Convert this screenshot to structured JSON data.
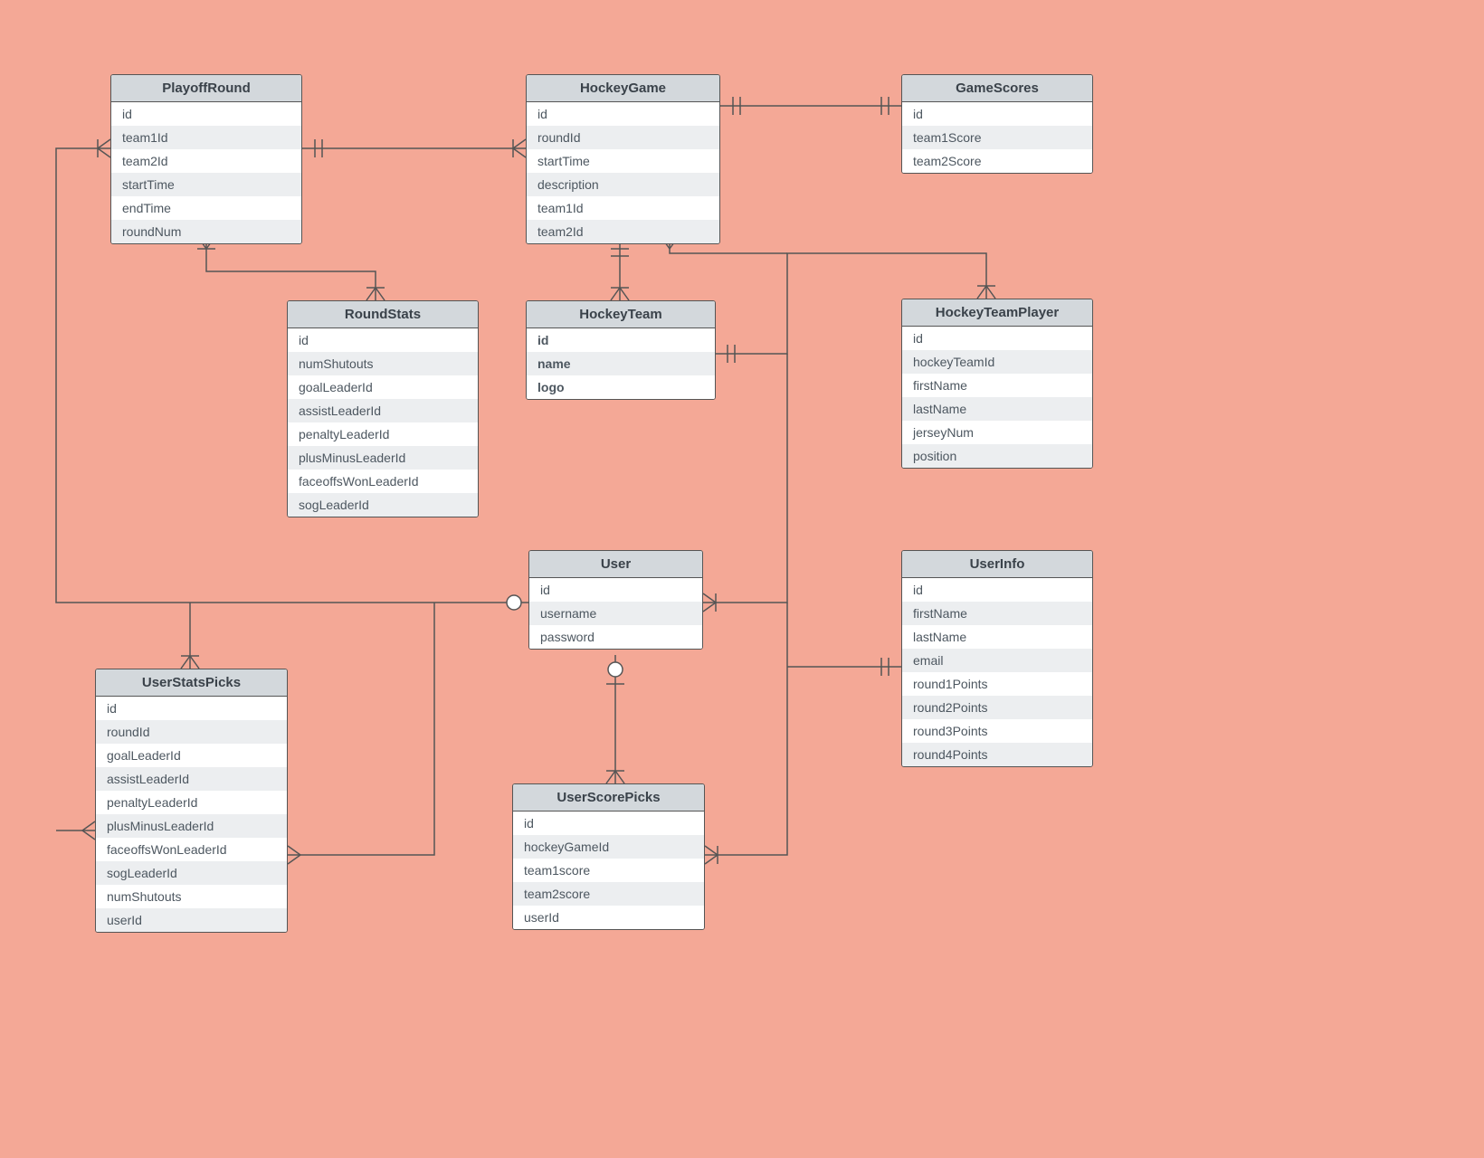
{
  "entities": {
    "playoffRound": {
      "title": "PlayoffRound",
      "rows": [
        "id",
        "team1Id",
        "team2Id",
        "startTime",
        "endTime",
        "roundNum"
      ]
    },
    "hockeyGame": {
      "title": "HockeyGame",
      "rows": [
        "id",
        "roundId",
        "startTime",
        "description",
        "team1Id",
        "team2Id"
      ]
    },
    "gameScores": {
      "title": "GameScores",
      "rows": [
        "id",
        "team1Score",
        "team2Score"
      ]
    },
    "roundStats": {
      "title": "RoundStats",
      "rows": [
        "id",
        "numShutouts",
        "goalLeaderId",
        "assistLeaderId",
        "penaltyLeaderId",
        "plusMinusLeaderId",
        "faceoffsWonLeaderId",
        "sogLeaderId"
      ]
    },
    "hockeyTeam": {
      "title": "HockeyTeam",
      "rows": [
        "id",
        "name",
        "logo"
      ],
      "boldRows": true
    },
    "hockeyTeamPlayer": {
      "title": "HockeyTeamPlayer",
      "rows": [
        "id",
        "hockeyTeamId",
        "firstName",
        "lastName",
        "jerseyNum",
        "position"
      ]
    },
    "user": {
      "title": "User",
      "rows": [
        "id",
        "username",
        "password"
      ]
    },
    "userInfo": {
      "title": "UserInfo",
      "rows": [
        "id",
        "firstName",
        "lastName",
        "email",
        "round1Points",
        "round2Points",
        "round3Points",
        "round4Points"
      ]
    },
    "userStatsPicks": {
      "title": "UserStatsPicks",
      "rows": [
        "id",
        "roundId",
        "goalLeaderId",
        "assistLeaderId",
        "penaltyLeaderId",
        "plusMinusLeaderId",
        "faceoffsWonLeaderId",
        "sogLeaderId",
        "numShutouts",
        "userId"
      ]
    },
    "userScorePicks": {
      "title": "UserScorePicks",
      "rows": [
        "id",
        "hockeyGameId",
        "team1score",
        "team2score",
        "userId"
      ]
    }
  }
}
